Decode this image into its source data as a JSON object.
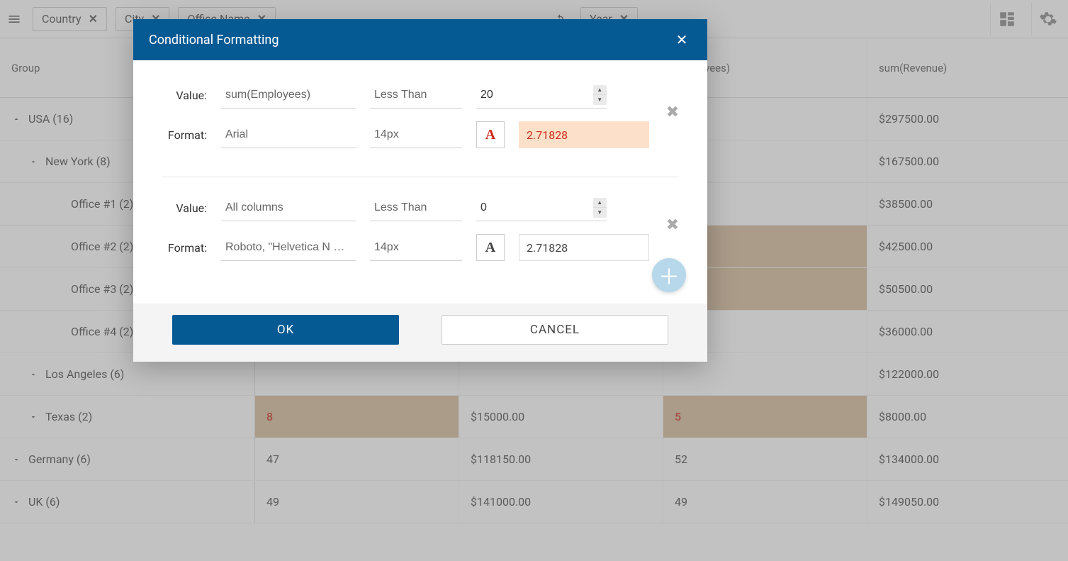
{
  "toolbar": {
    "chips": [
      {
        "label": "Country"
      },
      {
        "label": "City"
      },
      {
        "label": "Office Name"
      }
    ],
    "sigma_chip": {
      "label": "Year"
    }
  },
  "grid": {
    "group_header": "Group",
    "col2_header": "",
    "col3_header": "",
    "col4_header": "Employees)",
    "col5_header": "sum(Revenue)",
    "rows": [
      {
        "type": "group",
        "depth": 0,
        "caret": "up",
        "label": "USA (16)",
        "c2": "",
        "c3": "",
        "c4": "",
        "c5": "$297500.00",
        "hl2": false,
        "hl4": false
      },
      {
        "type": "group",
        "depth": 1,
        "caret": "up",
        "label": "New York (8)",
        "c2": "",
        "c3": "",
        "c4": "",
        "c5": "$167500.00",
        "hl2": false,
        "hl4": false
      },
      {
        "type": "leaf",
        "depth": 3,
        "caret": "",
        "label": "Office #1 (2)",
        "c2": "",
        "c3": "",
        "c4": "",
        "c5": "$38500.00",
        "hl2": false,
        "hl4": false
      },
      {
        "type": "leaf",
        "depth": 3,
        "caret": "",
        "label": "Office #2 (2)",
        "c2": "",
        "c3": "",
        "c4": "",
        "c5": "$42500.00",
        "hl2": false,
        "hl4": true
      },
      {
        "type": "leaf",
        "depth": 3,
        "caret": "",
        "label": "Office #3 (2)",
        "c2": "",
        "c3": "",
        "c4": "",
        "c5": "$50500.00",
        "hl2": false,
        "hl4": true
      },
      {
        "type": "leaf",
        "depth": 3,
        "caret": "",
        "label": "Office #4 (2)",
        "c2": "",
        "c3": "",
        "c4": "",
        "c5": "$36000.00",
        "hl2": false,
        "hl4": false
      },
      {
        "type": "group",
        "depth": 1,
        "caret": "down",
        "label": "Los Angeles (6)",
        "c2": "",
        "c3": "",
        "c4": "",
        "c5": "$122000.00",
        "hl2": false,
        "hl4": false
      },
      {
        "type": "group",
        "depth": 1,
        "caret": "down",
        "label": "Texas (2)",
        "c2": "8",
        "c3": "$15000.00",
        "c4": "5",
        "c5": "$8000.00",
        "hl2": true,
        "hl4": true
      },
      {
        "type": "group",
        "depth": 0,
        "caret": "down",
        "label": "Germany (6)",
        "c2": "47",
        "c3": "$118150.00",
        "c4": "52",
        "c5": "$134000.00",
        "hl2": false,
        "hl4": false
      },
      {
        "type": "group",
        "depth": 0,
        "caret": "down",
        "label": "UK (6)",
        "c2": "49",
        "c3": "$141000.00",
        "c4": "49",
        "c5": "$149050.00",
        "hl2": false,
        "hl4": false
      }
    ]
  },
  "modal": {
    "title": "Conditional Formatting",
    "value_label": "Value:",
    "format_label": "Format:",
    "ok_label": "OK",
    "cancel_label": "CANCEL",
    "rules": [
      {
        "column": "sum(Employees)",
        "operator": "Less Than",
        "threshold": "20",
        "font": "Arial",
        "size": "14px",
        "preview": "2.71828",
        "hl": true
      },
      {
        "column": "All columns",
        "operator": "Less Than",
        "threshold": "0",
        "font": "Roboto, \"Helvetica N …",
        "size": "14px",
        "preview": "2.71828",
        "hl": false
      }
    ]
  }
}
